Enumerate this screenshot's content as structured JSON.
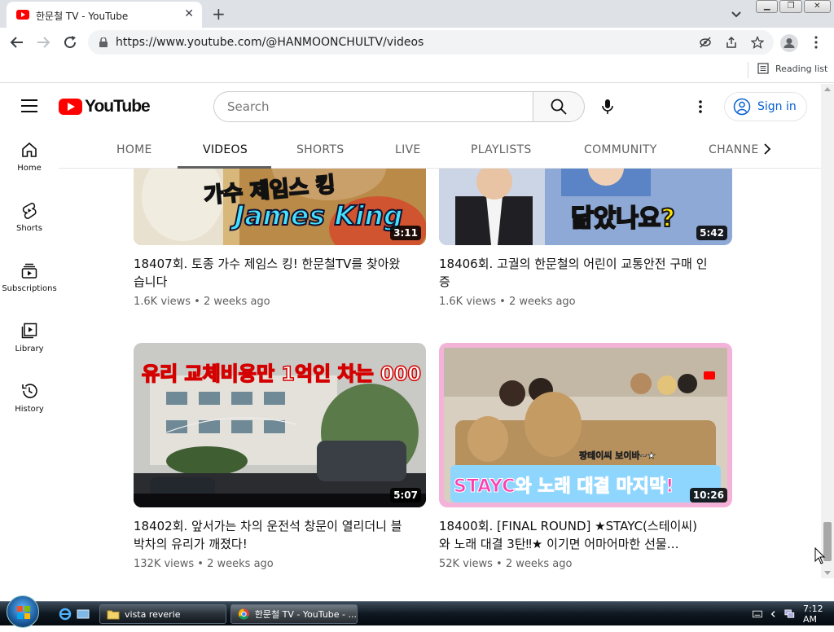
{
  "browser": {
    "tab_title": "한문철 TV - YouTube",
    "url": "https://www.youtube.com/@HANMOONCHULTV/videos",
    "reading_list": "Reading list"
  },
  "youtube": {
    "search_placeholder": "Search",
    "sign_in": "Sign in",
    "guide": [
      {
        "label": "Home",
        "icon": "home-icon"
      },
      {
        "label": "Shorts",
        "icon": "shorts-icon"
      },
      {
        "label": "Subscriptions",
        "icon": "subscriptions-icon"
      },
      {
        "label": "Library",
        "icon": "library-icon"
      },
      {
        "label": "History",
        "icon": "history-icon"
      }
    ],
    "channel_tabs": [
      "HOME",
      "VIDEOS",
      "SHORTS",
      "LIVE",
      "PLAYLISTS",
      "COMMUNITY",
      "CHANNELS"
    ],
    "active_tab": "VIDEOS",
    "videos": [
      {
        "title": "18407회. 토종 가수 제임스 킹! 한문철TV를 찾아왔습니다",
        "meta": "1.6K views • 2 weeks ago",
        "duration": "3:11",
        "thumb_text_1": "가수 제임스 킹",
        "thumb_text_2": "James King"
      },
      {
        "title": "18406회. 고궐의 한문철의 어린이 교통안전 구매 인증",
        "meta": "1.6K views • 2 weeks ago",
        "duration": "5:42",
        "thumb_text_1": "닮았나요?"
      },
      {
        "title": "18402회. 앞서가는 차의 운전석 창문이 열리더니 블박차의 유리가 깨졌다!",
        "meta": "132K views • 2 weeks ago",
        "duration": "5:07",
        "thumb_text_1": "유리 교체비용만 1억인 차는 000"
      },
      {
        "title": "18400회. [FINAL ROUND] ★STAYC(스테이씨)와 노래 대결 3탄‼★ 이기면 어마어마한 선물…",
        "meta": "52K views • 2 weeks ago",
        "duration": "10:26",
        "thumb_text_1": "STAYC와 노래 대결 마지막!",
        "thumb_text_2": "팡테이씨 보이바~★"
      }
    ]
  },
  "taskbar": {
    "tasks": [
      "vista reverie",
      "한문철 TV - YouTube - ..."
    ],
    "clock": "7:12 AM"
  },
  "colors": {
    "youtube_red": "#ff0000",
    "link_blue": "#065fd4"
  }
}
